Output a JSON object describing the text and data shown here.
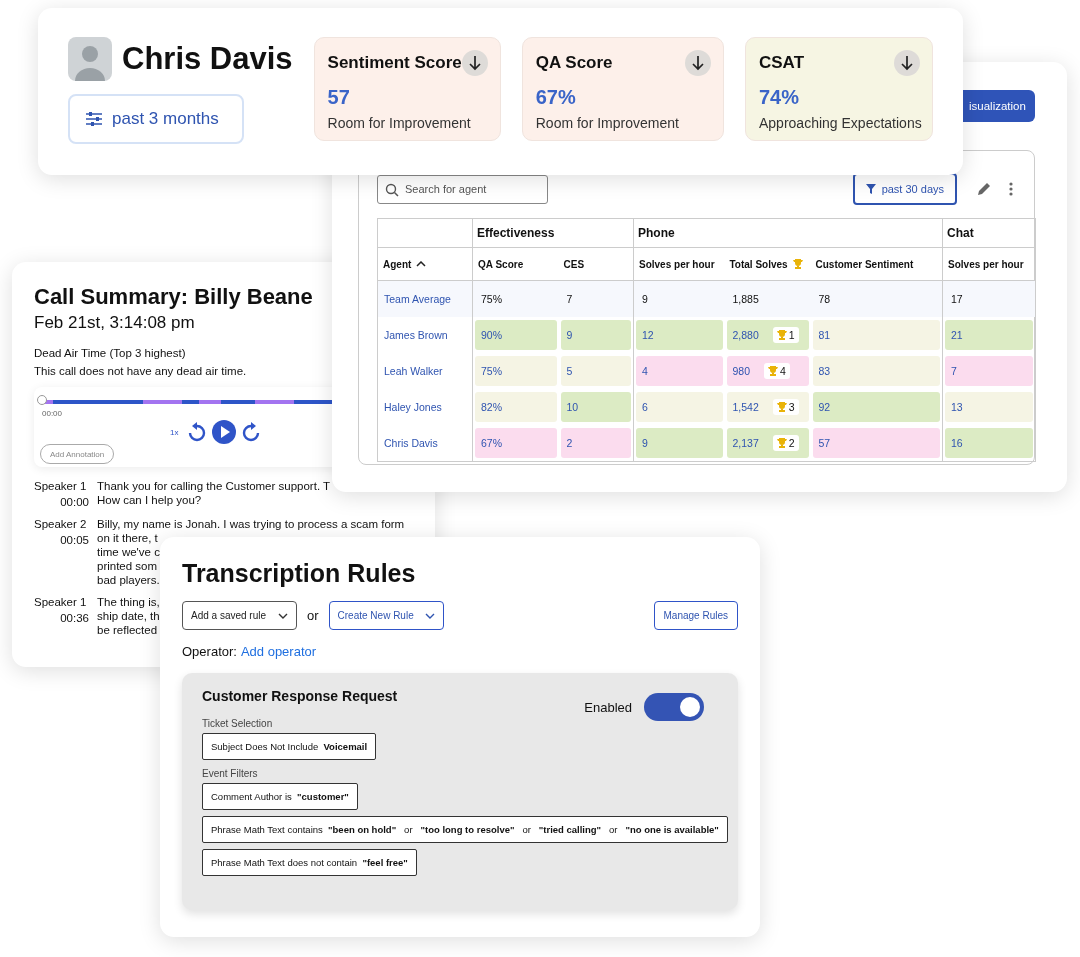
{
  "call_summary": {
    "title": "Call Summary: Billy Beane",
    "datetime": "Feb 21st, 3:14:08 pm",
    "dead_air_heading": "Dead Air Time (Top 3 highest)",
    "dead_air_text": "This call does not have any dead air time.",
    "player": {
      "time": "00:00",
      "level": 0,
      "speed": "1x",
      "annotation_button": "Add Annotation"
    },
    "transcript": [
      {
        "speaker": "Speaker 1",
        "time": "00:00",
        "lines": [
          "Thank you for calling the Customer support. T",
          "How can I help you?"
        ]
      },
      {
        "speaker": "Speaker 2",
        "time": "00:05",
        "lines": [
          "Billy, my name is Jonah. I was trying to process a scam form",
          "on it there, t",
          "time we've c",
          "printed som",
          "bad players."
        ]
      },
      {
        "speaker": "Speaker 1",
        "time": "00:36",
        "lines": [
          "The thing is,",
          "ship date, th",
          "be reflected"
        ]
      }
    ]
  },
  "dashboard": {
    "visualization_button": "isualization",
    "search": {
      "placeholder": "Search for agent"
    },
    "filter_button": "past 30 days",
    "table": {
      "groups": [
        {
          "columns": [
            {
              "label": "Agent",
              "sort_ascending": true
            }
          ]
        },
        {
          "label": "Effectiveness",
          "columns": [
            {
              "label": "QA Score"
            },
            {
              "label": "CES"
            }
          ]
        },
        {
          "label": "Phone",
          "columns": [
            {
              "label": "Solves per hour"
            },
            {
              "label": "Total Solves",
              "kind": "ranked"
            },
            {
              "label": "Customer Sentiment"
            }
          ]
        },
        {
          "label": "Chat",
          "columns": [
            {
              "label": "Solves per hour"
            }
          ]
        }
      ],
      "rows": [
        {
          "kind": "average",
          "cells": [
            {
              "value": "Team Average"
            },
            {
              "value": "75%"
            },
            {
              "value": "7"
            },
            {
              "value": "9"
            },
            {
              "value": "1,885"
            },
            {
              "value": "78"
            },
            {
              "value": "17"
            }
          ]
        },
        {
          "kind": "agent",
          "cells": [
            {
              "value": "James Brown"
            },
            {
              "value": "90%",
              "color": "#dcebc4"
            },
            {
              "value": "9",
              "color": "#dcebc4"
            },
            {
              "value": "12",
              "color": "#dcebc4"
            },
            {
              "value": "2,880",
              "color": "#dcebc4",
              "rank": "1"
            },
            {
              "value": "81",
              "color": "#f5f4e4"
            },
            {
              "value": "21",
              "color": "#dcebc4"
            }
          ]
        },
        {
          "kind": "agent",
          "cells": [
            {
              "value": "Leah Walker"
            },
            {
              "value": "75%",
              "color": "#f5f4e4"
            },
            {
              "value": "5",
              "color": "#f5f4e4"
            },
            {
              "value": "4",
              "color": "#fbdcee"
            },
            {
              "value": "980",
              "color": "#fbdcee",
              "rank": "4"
            },
            {
              "value": "83",
              "color": "#f5f4e4"
            },
            {
              "value": "7",
              "color": "#fbdcee"
            }
          ]
        },
        {
          "kind": "agent",
          "cells": [
            {
              "value": "Haley Jones"
            },
            {
              "value": "82%",
              "color": "#f5f4e4"
            },
            {
              "value": "10",
              "color": "#dcebc4"
            },
            {
              "value": "6",
              "color": "#f5f4e4"
            },
            {
              "value": "1,542",
              "color": "#f5f4e4",
              "rank": "3"
            },
            {
              "value": "92",
              "color": "#dcebc4"
            },
            {
              "value": "13",
              "color": "#f5f4e4"
            }
          ]
        },
        {
          "kind": "agent",
          "cells": [
            {
              "value": "Chris Davis"
            },
            {
              "value": "67%",
              "color": "#fbdcee"
            },
            {
              "value": "2",
              "color": "#fbdcee"
            },
            {
              "value": "9",
              "color": "#dcebc4"
            },
            {
              "value": "2,137",
              "color": "#dcebc4",
              "rank": "2"
            },
            {
              "value": "57",
              "color": "#fbdcee"
            },
            {
              "value": "16",
              "color": "#dcebc4"
            }
          ]
        }
      ]
    }
  },
  "profile": {
    "name": "Chris Davis",
    "period_button": "past 3 months",
    "score_cards": [
      {
        "title": "Sentiment Score",
        "value": "57",
        "caption": "Room for Improvement",
        "color": "#fdf0ea"
      },
      {
        "title": "QA Score",
        "value": "67%",
        "caption": "Room for Improvement",
        "color": "#fdf0ea"
      },
      {
        "title": "CSAT",
        "value": "74%",
        "caption": "Approaching Expectations",
        "color": "#f6f5e3"
      }
    ]
  },
  "transcription_rules": {
    "title": "Transcription Rules",
    "saved_rule_dropdown": "Add a saved rule",
    "or_text": "or",
    "create_dropdown": "Create New Rule",
    "manage_button": "Manage Rules",
    "operator_label": "Operator:",
    "operator_link": "Add operator",
    "rule": {
      "title": "Customer Response Request",
      "enabled_label": "Enabled",
      "enabled": true,
      "sections": [
        {
          "heading": "Ticket Selection",
          "filters": [
            "Subject Does Not Include  **Voicemail**"
          ]
        },
        {
          "heading": "Event Filters",
          "filters": [
            "Comment Author is  **\"customer\"**",
            "Phrase Math Text contains  **\"been on hold\"**   or   **\"too long to resolve\"**   or   **\"tried calling\"**   or   **\"no one is available\"**",
            "Phrase Math Text does not contain  **\"feel free\"**"
          ]
        }
      ]
    }
  }
}
